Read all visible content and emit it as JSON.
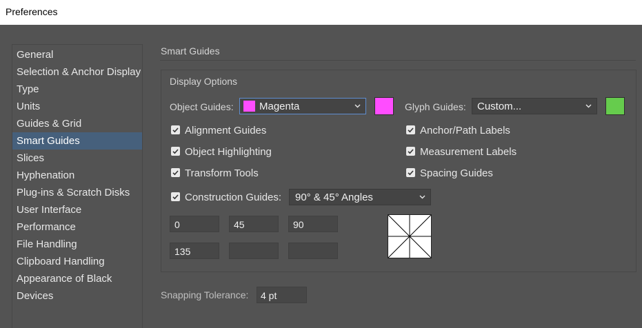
{
  "window": {
    "title": "Preferences"
  },
  "sidebar": {
    "items": [
      {
        "label": "General"
      },
      {
        "label": "Selection & Anchor Display"
      },
      {
        "label": "Type"
      },
      {
        "label": "Units"
      },
      {
        "label": "Guides & Grid"
      },
      {
        "label": "Smart Guides",
        "selected": true
      },
      {
        "label": "Slices"
      },
      {
        "label": "Hyphenation"
      },
      {
        "label": "Plug-ins & Scratch Disks"
      },
      {
        "label": "User Interface"
      },
      {
        "label": "Performance"
      },
      {
        "label": "File Handling"
      },
      {
        "label": "Clipboard Handling"
      },
      {
        "label": "Appearance of Black"
      },
      {
        "label": "Devices"
      }
    ]
  },
  "panel": {
    "title": "Smart Guides",
    "display_options": {
      "legend": "Display Options",
      "object_guides": {
        "label": "Object Guides:",
        "value": "Magenta",
        "color": "#ff4dff"
      },
      "glyph_guides": {
        "label": "Glyph Guides:",
        "value": "Custom...",
        "color": "#66cc4d"
      },
      "checkboxes_left": [
        {
          "label": "Alignment Guides",
          "checked": true
        },
        {
          "label": "Object Highlighting",
          "checked": true
        },
        {
          "label": "Transform Tools",
          "checked": true
        }
      ],
      "checkboxes_right": [
        {
          "label": "Anchor/Path Labels",
          "checked": true
        },
        {
          "label": "Measurement Labels",
          "checked": true
        },
        {
          "label": "Spacing Guides",
          "checked": true
        }
      ],
      "construction_guides": {
        "label": "Construction Guides:",
        "checked": true,
        "value": "90° & 45° Angles",
        "angles": [
          "0",
          "45",
          "90",
          "135",
          "",
          ""
        ]
      }
    },
    "snapping": {
      "label": "Snapping Tolerance:",
      "value": "4 pt"
    }
  },
  "colors": {
    "background": "#535353",
    "selection": "#46607c",
    "focus_border": "#5f8ed1"
  }
}
